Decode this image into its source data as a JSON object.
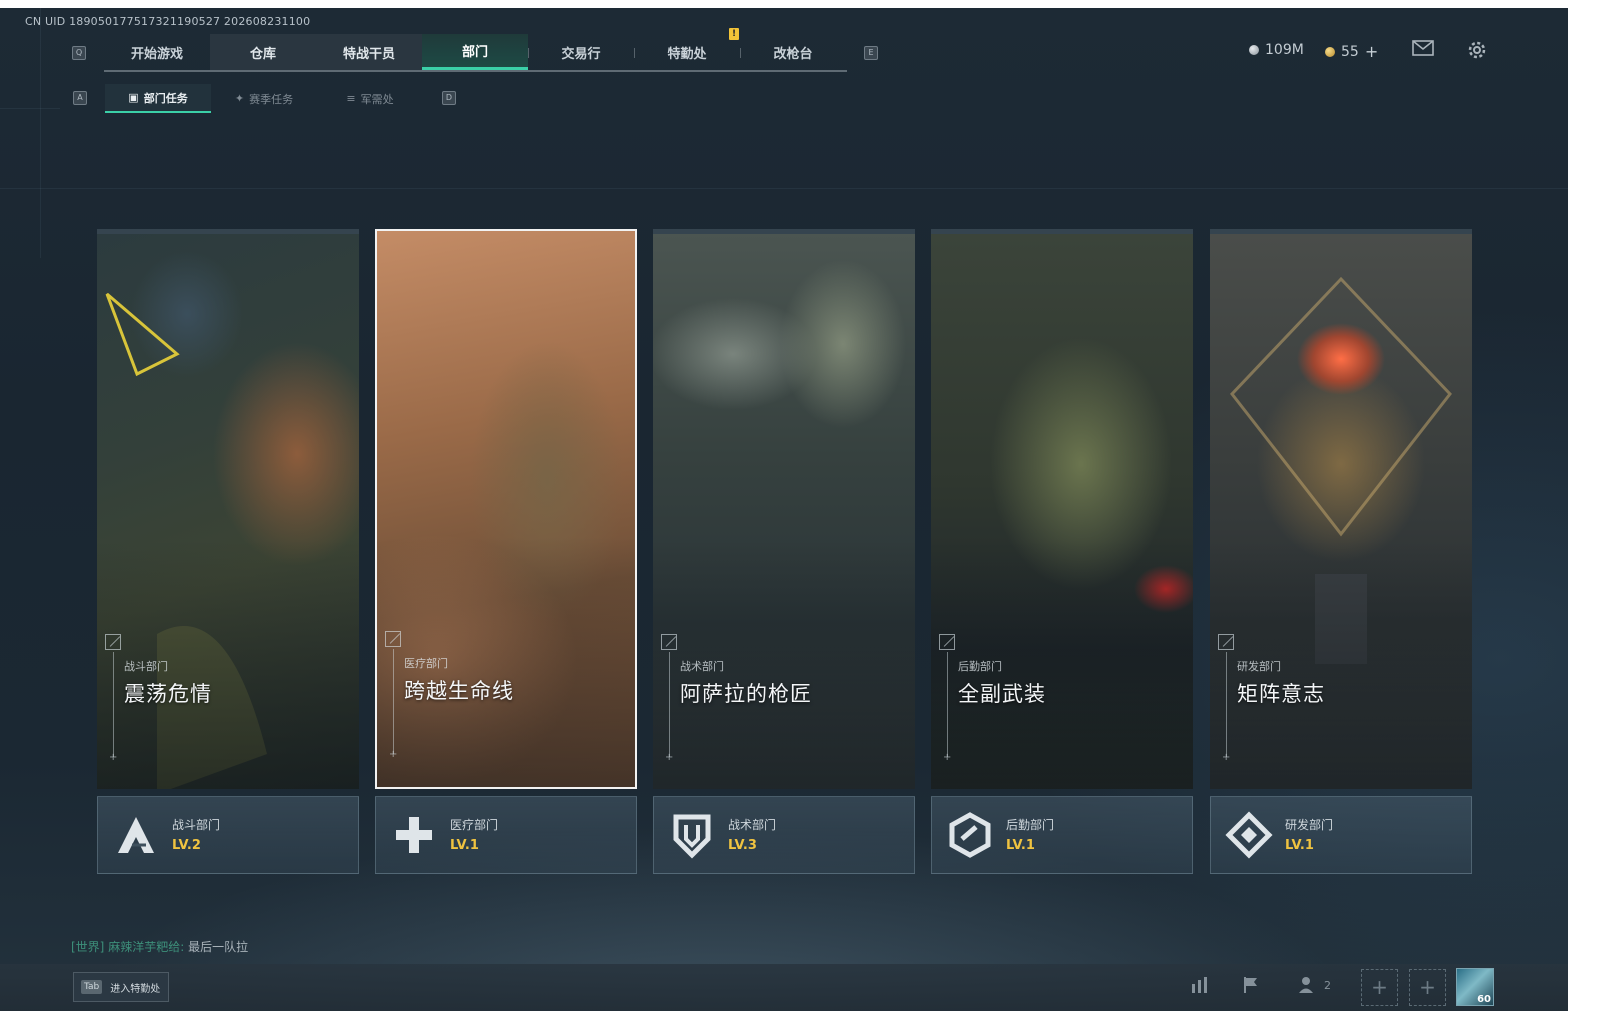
{
  "uid": "CN UID 189050177517321190527 202608231100",
  "keys": {
    "prev_main": "Q",
    "next_main": "E",
    "prev_sub": "A",
    "next_sub": "D"
  },
  "top_nav": {
    "tabs": [
      {
        "label": "开始游戏"
      },
      {
        "label": "仓库"
      },
      {
        "label": "特战干员"
      },
      {
        "label": "部门"
      },
      {
        "label": "交易行"
      },
      {
        "label": "特勤处"
      },
      {
        "label": "改枪台"
      }
    ],
    "active_index": 3,
    "alert": "!"
  },
  "currency": {
    "silver": "109M",
    "gold": "55",
    "plus": "+"
  },
  "icons": {
    "mail": "mail-icon",
    "settings": "gear-icon"
  },
  "sub_nav": {
    "tabs": [
      {
        "label": "部门任务",
        "icon": "task-icon"
      },
      {
        "label": "赛季任务",
        "icon": "season-icon"
      },
      {
        "label": "军需处",
        "icon": "supply-icon"
      }
    ],
    "active_index": 0
  },
  "departments": [
    {
      "dept": "战斗部门",
      "title": "震荡危情",
      "level": "LV.2",
      "icon": "combat-icon",
      "selected": false
    },
    {
      "dept": "医疗部门",
      "title": "跨越生命线",
      "level": "LV.1",
      "icon": "medical-icon",
      "selected": true
    },
    {
      "dept": "战术部门",
      "title": "阿萨拉的枪匠",
      "level": "LV.3",
      "icon": "tactical-shield-icon",
      "selected": false
    },
    {
      "dept": "后勤部门",
      "title": "全副武装",
      "level": "LV.1",
      "icon": "logistics-icon",
      "selected": false
    },
    {
      "dept": "研发部门",
      "title": "矩阵意志",
      "level": "LV.1",
      "icon": "research-icon",
      "selected": false
    }
  ],
  "chat": {
    "channel": "[世界]",
    "name": "麻辣洋芋粑给:",
    "message": "最后一队拉"
  },
  "bottom": {
    "tab_key": "Tab",
    "tab_label": "进入特勤处",
    "squad_count": "2",
    "avatar_level": "60"
  },
  "colors": {
    "accent": "#3bd0a8",
    "level": "#f0c340"
  }
}
